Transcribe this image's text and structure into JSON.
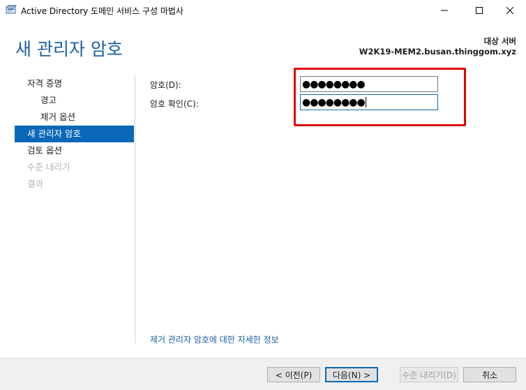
{
  "window": {
    "title": "Active Directory 도메인 서비스 구성 마법사",
    "icon": "ad-server-icon"
  },
  "header": {
    "page_title": "새 관리자 암호",
    "target_label": "대상 서버",
    "target_server": "W2K19-MEM2.busan.thinggom.xyz"
  },
  "nav": {
    "items": [
      {
        "label": "자격 증명",
        "state": "normal"
      },
      {
        "label": "경고",
        "state": "sub"
      },
      {
        "label": "제거 옵션",
        "state": "sub"
      },
      {
        "label": "새 관리자 암호",
        "state": "active"
      },
      {
        "label": "검토 옵션",
        "state": "normal"
      },
      {
        "label": "수준 내리기",
        "state": "disabled"
      },
      {
        "label": "결과",
        "state": "disabled"
      }
    ]
  },
  "form": {
    "password_label": "암호(D):",
    "password_value": "●●●●●●●●",
    "confirm_label": "암호 확인(C):",
    "confirm_value": "●●●●●●●●"
  },
  "more_link": "제거 관리자 암호에 대한 자세한 정보",
  "buttons": {
    "prev": "< 이전(P)",
    "next": "다음(N) >",
    "demote": "수준 내리기(D)",
    "cancel": "취소"
  },
  "colors": {
    "accent": "#0b67b7",
    "title": "#1a5ea6",
    "highlight": "#e00000"
  }
}
